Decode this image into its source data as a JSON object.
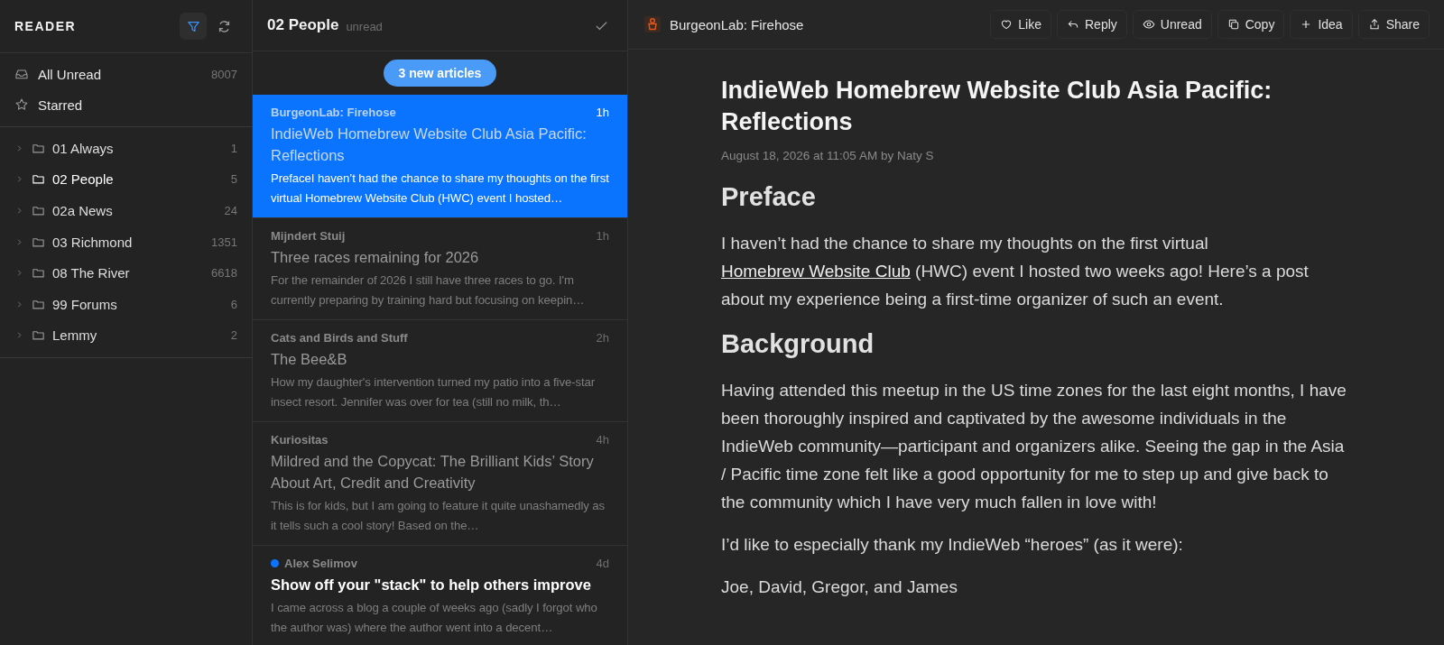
{
  "sidebar": {
    "title": "READER",
    "tools": [
      {
        "kind": "filter",
        "selected": true
      },
      {
        "kind": "refresh",
        "selected": false
      }
    ],
    "items": [
      {
        "kind": "inbox",
        "label": "All Unread",
        "count": "8007"
      },
      {
        "kind": "star",
        "label": "Starred"
      }
    ],
    "folders": [
      {
        "label": "01 Always",
        "count": "1",
        "selected": false,
        "expanded": false
      },
      {
        "label": "02 People",
        "count": "5",
        "selected": true,
        "expanded": false
      },
      {
        "label": "02a News",
        "count": "24",
        "selected": false,
        "expanded": false
      },
      {
        "label": "03 Richmond",
        "count": "1351",
        "selected": false,
        "expanded": false
      },
      {
        "label": "08 The River",
        "count": "6618",
        "selected": false,
        "expanded": false
      },
      {
        "label": "99 Forums",
        "count": "6",
        "selected": false,
        "expanded": false
      },
      {
        "label": "Lemmy",
        "count": "2",
        "selected": false,
        "expanded": false
      }
    ]
  },
  "list": {
    "title": "02 People",
    "filter": "unread",
    "banner": "3 new articles",
    "articles": [
      {
        "source": "BurgeonLab: Firehose",
        "time": "1h",
        "title": "IndieWeb Homebrew Website Club Asia Pacific: Reflections",
        "excerpt": "PrefaceI haven’t had the chance to share my thoughts on the first virtual Homebrew Website Club (HWC) event I hosted…",
        "selected": true,
        "unread": false
      },
      {
        "source": "Mijndert Stuij",
        "time": "1h",
        "title": "Three races remaining for 2026",
        "excerpt": "For the remainder of 2026 I still have three races to go. I'm currently preparing by training hard but focusing on keepin…",
        "selected": false,
        "unread": false
      },
      {
        "source": "Cats and Birds and Stuff",
        "time": "2h",
        "title": "The Bee&B",
        "excerpt": "How my daughter's intervention turned my patio into a five-star insect resort. Jennifer was over for tea (still no milk, th…",
        "selected": false,
        "unread": false
      },
      {
        "source": "Kuriositas",
        "time": "4h",
        "title": "Mildred and the Copycat: The Brilliant Kids’ Story About Art, Credit and Creativity",
        "excerpt": "This is for kids, but I am going to feature it quite unashamedly as it tells such a cool story! Based on the…",
        "selected": false,
        "unread": false
      },
      {
        "source": "Alex Selimov",
        "time": "4d",
        "title": "Show off your \"stack\" to help others improve",
        "excerpt": "I came across a blog a couple of weeks ago (sadly I forgot who the author was) where the author went into a decent…",
        "selected": false,
        "unread": true
      }
    ]
  },
  "article": {
    "feed": "BurgeonLab: Firehose",
    "actions": [
      {
        "kind": "like",
        "label": "Like"
      },
      {
        "kind": "reply",
        "label": "Reply"
      },
      {
        "kind": "unread",
        "label": "Unread"
      },
      {
        "kind": "copy",
        "label": "Copy"
      },
      {
        "kind": "idea",
        "label": "Idea"
      },
      {
        "kind": "share",
        "label": "Share"
      }
    ],
    "title": "IndieWeb Homebrew Website Club Asia Pacific: Reflections",
    "meta": "August 18, 2026 at 11:05 AM by Naty S",
    "body": [
      {
        "kind": "heading",
        "parts": [
          {
            "text": "Preface"
          }
        ]
      },
      {
        "kind": "paragraph",
        "parts": [
          {
            "text": "I haven’t had the chance to share my thoughts on the first virtual "
          },
          {
            "text": "Homebrew Website Club",
            "link": true
          },
          {
            "text": " (HWC) event I hosted two weeks ago! Here’s a post about my experience being a first-time organizer of such an event."
          }
        ]
      },
      {
        "kind": "heading",
        "parts": [
          {
            "text": "Background"
          }
        ]
      },
      {
        "kind": "paragraph",
        "parts": [
          {
            "text": "Having attended this meetup in the US time zones for the last eight months, I have been thoroughly inspired and captivated by the awesome individuals in the IndieWeb community—participant and organizers alike. Seeing the gap in the Asia / Pacific time zone felt like a good opportunity for me to step up and give back to the community which I have very much fallen in love with!"
          }
        ]
      },
      {
        "kind": "paragraph",
        "parts": [
          {
            "text": "I’d like to especially thank my IndieWeb “heroes” (as it were):"
          }
        ]
      },
      {
        "kind": "paragraph",
        "parts": [
          {
            "text": "Joe, David, Gregor, and James"
          }
        ]
      }
    ]
  }
}
